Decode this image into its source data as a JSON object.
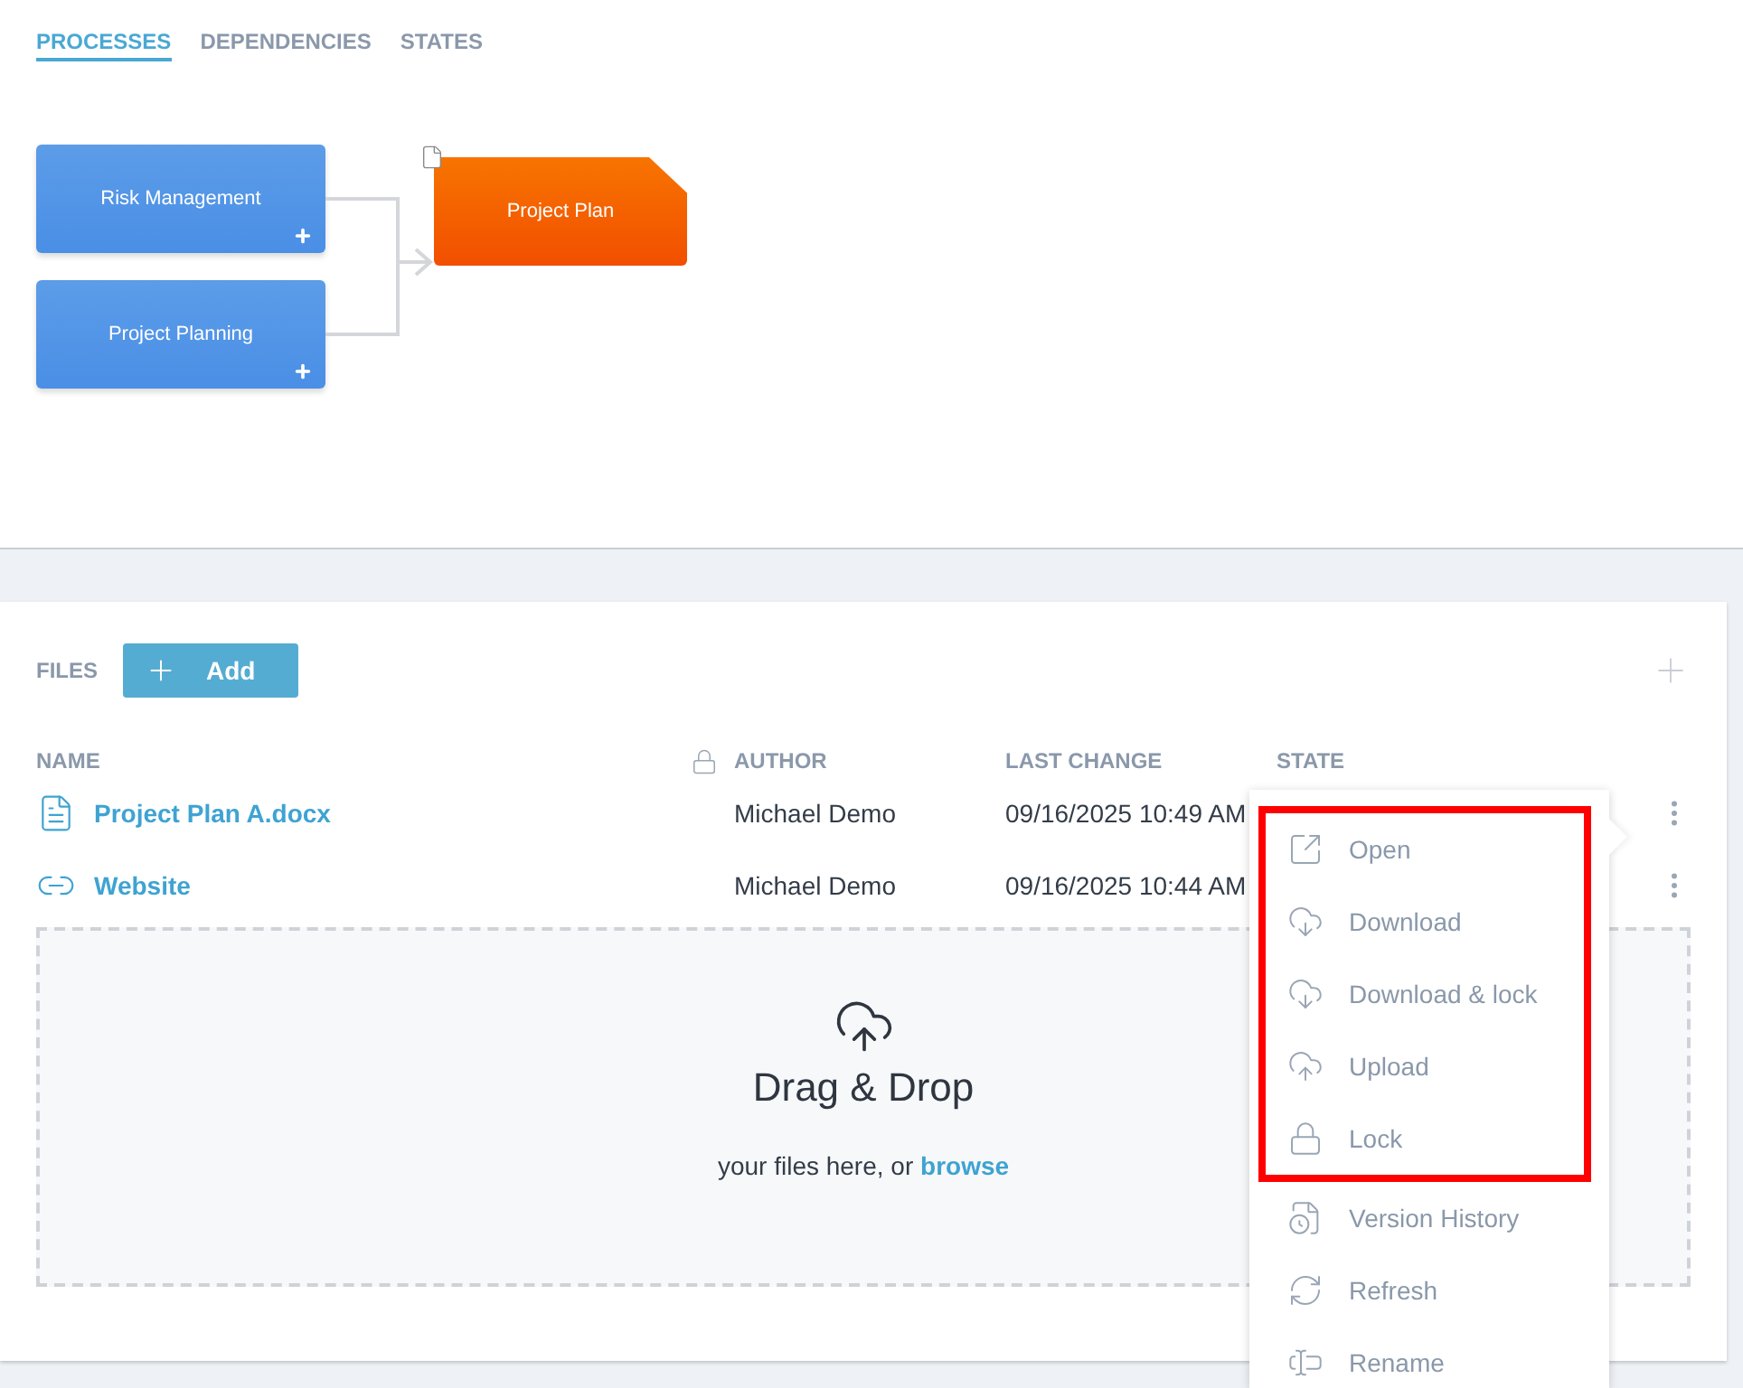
{
  "tabs": [
    {
      "label": "PROCESSES",
      "selected": true
    },
    {
      "label": "DEPENDENCIES",
      "selected": false
    },
    {
      "label": "STATES",
      "selected": false
    }
  ],
  "diagram": {
    "inputs": [
      {
        "label": "Risk Management"
      },
      {
        "label": "Project Planning"
      }
    ],
    "output": {
      "label": "Project Plan"
    }
  },
  "files": {
    "title": "FILES",
    "add_button": "Add",
    "columns": {
      "name": "NAME",
      "author": "AUTHOR",
      "last_change": "LAST CHANGE",
      "state": "STATE"
    },
    "rows": [
      {
        "kind": "file",
        "name": "Project Plan A.docx",
        "author": "Michael Demo",
        "last_change": "09/16/2025 10:49 AM"
      },
      {
        "kind": "link",
        "name": "Website",
        "author": "Michael Demo",
        "last_change": "09/16/2025 10:44 AM"
      }
    ],
    "dropzone": {
      "title": "Drag & Drop",
      "text": "your files here, or ",
      "link": "browse"
    }
  },
  "context_menu": {
    "items": [
      {
        "label": "Open",
        "highlighted": true
      },
      {
        "label": "Download",
        "highlighted": true
      },
      {
        "label": "Download & lock",
        "highlighted": true
      },
      {
        "label": "Upload",
        "highlighted": true
      },
      {
        "label": "Lock",
        "highlighted": true
      },
      {
        "label": "Version History",
        "highlighted": false
      },
      {
        "label": "Refresh",
        "highlighted": false
      },
      {
        "label": "Rename",
        "highlighted": false
      }
    ]
  }
}
